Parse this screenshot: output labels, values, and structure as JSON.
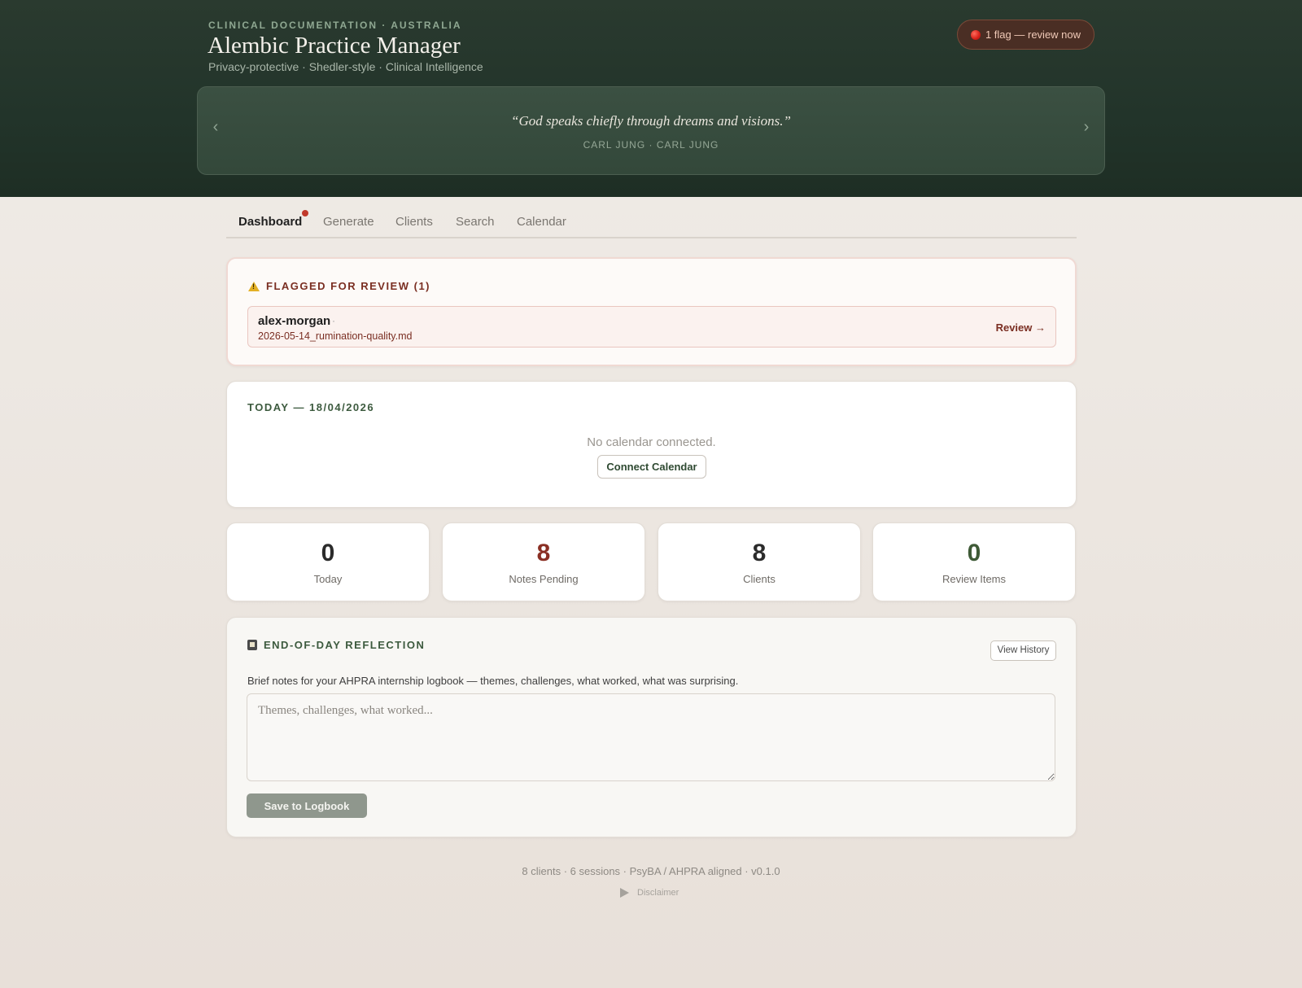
{
  "header": {
    "eyebrow": "CLINICAL DOCUMENTATION · AUSTRALIA",
    "title": "Alembic Practice Manager",
    "subtitle": "Privacy-protective · Shedler-style · Clinical Intelligence",
    "flag_pill": "1 flag — review now"
  },
  "quote": {
    "prev": "‹",
    "next": "›",
    "text": "“God speaks chiefly through dreams and visions.”",
    "attribution": "CARL JUNG · CARL JUNG"
  },
  "tabs": [
    {
      "label": "Dashboard",
      "active": true
    },
    {
      "label": "Generate"
    },
    {
      "label": "Clients"
    },
    {
      "label": "Search"
    },
    {
      "label": "Calendar"
    }
  ],
  "flagged": {
    "heading": "FLAGGED FOR REVIEW (1)",
    "client": "alex-morgan",
    "separator": "·",
    "file": "2026-05-14_rumination-quality.md",
    "action": "Review →"
  },
  "today": {
    "heading": "TODAY — 18/04/2026",
    "empty": "No calendar connected.",
    "connect": "Connect Calendar"
  },
  "stats": [
    {
      "value": "0",
      "label": "Today",
      "color": "#2b2b2b"
    },
    {
      "value": "8",
      "label": "Notes Pending",
      "color": "#8a2f24"
    },
    {
      "value": "8",
      "label": "Clients",
      "color": "#2b2b2b"
    },
    {
      "value": "0",
      "label": "Review Items",
      "color": "#3e5a36"
    }
  ],
  "reflection": {
    "heading": "END-OF-DAY REFLECTION",
    "history": "View History",
    "description": "Brief notes for your AHPRA internship logbook — themes, challenges, what worked, what was surprising.",
    "placeholder": "Themes, challenges, what worked...",
    "value": "",
    "save": "Save to Logbook"
  },
  "footer": {
    "stats": "8 clients · 6 sessions · PsyBA / AHPRA aligned · v0.1.0",
    "disclaimer": "Disclaimer"
  },
  "icons": {
    "flag": "red-dot-icon",
    "warning": "warning-icon",
    "book": "book-icon",
    "disclaimer": "triangle-right-icon"
  }
}
